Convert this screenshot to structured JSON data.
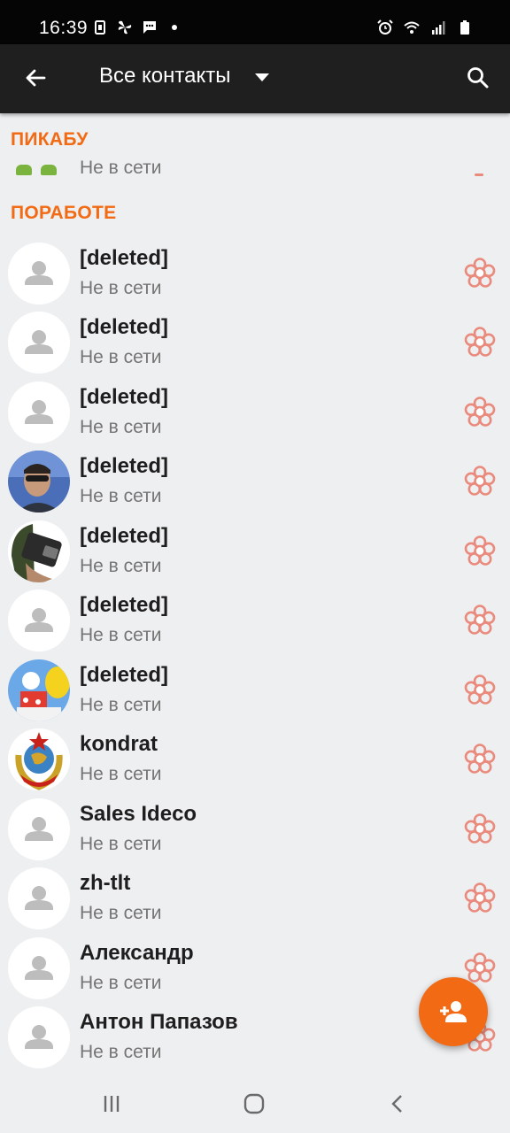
{
  "status_bar": {
    "time": "16:39",
    "left_icons": [
      "screenshot-icon",
      "pinwheel-icon",
      "message-icon",
      "dot-icon"
    ],
    "right_icons": [
      "alarm-icon",
      "wifi-icon",
      "signal-icon",
      "battery-icon"
    ]
  },
  "app_bar": {
    "title": "Все контакты",
    "back_icon": "arrow-left-icon",
    "search_icon": "search-icon",
    "dropdown_icon": "caret-down-icon"
  },
  "groups": [
    {
      "title": "ПИКАБУ",
      "contacts": [
        {
          "status": "Не в сети",
          "avatar": "green-icons"
        }
      ]
    },
    {
      "title": "ПОРАБОТЕ",
      "contacts": [
        {
          "name": "[deleted]",
          "status": "Не в сети",
          "avatar": "default"
        },
        {
          "name": "[deleted]",
          "status": "Не в сети",
          "avatar": "default"
        },
        {
          "name": "[deleted]",
          "status": "Не в сети",
          "avatar": "default"
        },
        {
          "name": "[deleted]",
          "status": "Не в сети",
          "avatar": "photo-man-sunglasses"
        },
        {
          "name": "[deleted]",
          "status": "Не в сети",
          "avatar": "photo-camera-hand"
        },
        {
          "name": "[deleted]",
          "status": "Не в сети",
          "avatar": "default"
        },
        {
          "name": "[deleted]",
          "status": "Не в сети",
          "avatar": "cartoon-illustration"
        },
        {
          "name": "kondrat",
          "status": "Не в сети",
          "avatar": "ussr-emblem"
        },
        {
          "name": "Sales Ideco",
          "status": "Не в сети",
          "avatar": "default"
        },
        {
          "name": "zh-tlt",
          "status": "Не в сети",
          "avatar": "default"
        },
        {
          "name": "Александр",
          "status": "Не в сети",
          "avatar": "default"
        },
        {
          "name": "Антон Папазов",
          "status": "Не в сети",
          "avatar": "default"
        }
      ]
    }
  ],
  "colors": {
    "accent": "#f26a13",
    "flower": "#e98a7c",
    "app_bar": "#1f1f1f",
    "background": "#eeeff1"
  },
  "fab": {
    "icon": "add-person-icon"
  },
  "nav_bar": {
    "icons": [
      "recent-apps-icon",
      "home-icon",
      "back-icon"
    ]
  }
}
